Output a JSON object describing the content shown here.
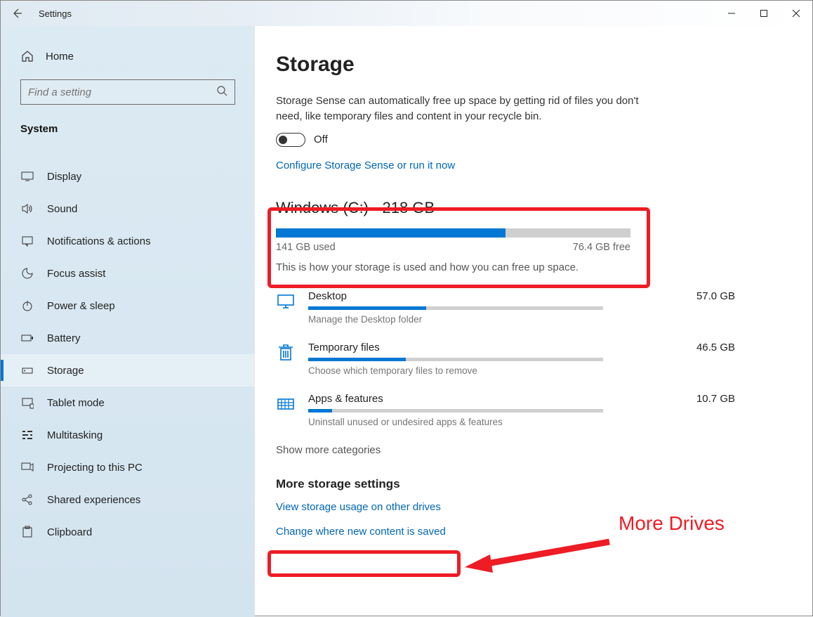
{
  "window": {
    "title": "Settings"
  },
  "sidebar": {
    "home": "Home",
    "search_placeholder": "Find a setting",
    "category": "System",
    "items": [
      {
        "icon": "display",
        "label": "Display"
      },
      {
        "icon": "sound",
        "label": "Sound"
      },
      {
        "icon": "notifications",
        "label": "Notifications & actions"
      },
      {
        "icon": "focus",
        "label": "Focus assist"
      },
      {
        "icon": "power",
        "label": "Power & sleep"
      },
      {
        "icon": "battery",
        "label": "Battery"
      },
      {
        "icon": "storage",
        "label": "Storage",
        "selected": true
      },
      {
        "icon": "tablet",
        "label": "Tablet mode"
      },
      {
        "icon": "multitask",
        "label": "Multitasking"
      },
      {
        "icon": "projecting",
        "label": "Projecting to this PC"
      },
      {
        "icon": "shared",
        "label": "Shared experiences"
      },
      {
        "icon": "clipboard",
        "label": "Clipboard"
      }
    ]
  },
  "main": {
    "heading": "Storage",
    "desc": "Storage Sense can automatically free up space by getting rid of files you don't need, like temporary files and content in your recycle bin.",
    "toggle_state": "Off",
    "configure_link": "Configure Storage Sense or run it now",
    "drive": {
      "title": "Windows (C:) - 218 GB",
      "used_label": "141 GB used",
      "free_label": "76.4 GB free",
      "pct": 64.7
    },
    "usage_hint": "This is how your storage is used and how you can free up space.",
    "categories": [
      {
        "icon": "desktop",
        "name": "Desktop",
        "size": "57.0 GB",
        "sub": "Manage the Desktop folder",
        "pct": 40
      },
      {
        "icon": "trash",
        "name": "Temporary files",
        "size": "46.5 GB",
        "sub": "Choose which temporary files to remove",
        "pct": 33
      },
      {
        "icon": "apps",
        "name": "Apps & features",
        "size": "10.7 GB",
        "sub": "Uninstall unused or undesired apps & features",
        "pct": 8
      }
    ],
    "show_more": "Show more categories",
    "more_heading": "More storage settings",
    "more_links": [
      "View storage usage on other drives",
      "Change where new content is saved"
    ]
  },
  "annotation": "More Drives"
}
